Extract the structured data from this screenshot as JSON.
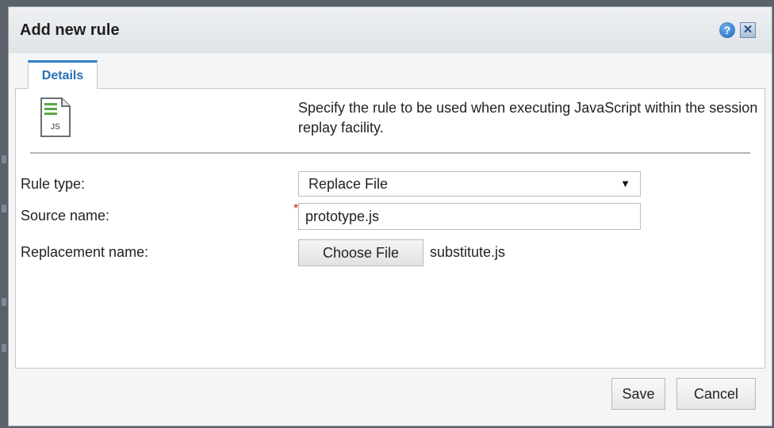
{
  "dialog": {
    "title": "Add new rule",
    "help_icon": "question-circle-icon",
    "close_icon": "close-x-icon"
  },
  "tabs": [
    {
      "label": "Details",
      "selected": true
    }
  ],
  "details": {
    "file_icon": "javascript-file-icon",
    "file_icon_text": "JS",
    "description": "Specify the rule to be used when executing JavaScript within the session replay facility."
  },
  "form": {
    "rule_type": {
      "label": "Rule type:",
      "value": "Replace File",
      "arrow": "▼"
    },
    "source_name": {
      "label": "Source name:",
      "required_marker": "*",
      "value": "prototype.js"
    },
    "replacement_name": {
      "label": "Replacement name:",
      "button_label": "Choose File",
      "file_name": "substitute.js"
    }
  },
  "footer": {
    "save_label": "Save",
    "cancel_label": "Cancel"
  },
  "colors": {
    "tab_accent": "#2f7fc8",
    "required": "#d01c1c"
  }
}
